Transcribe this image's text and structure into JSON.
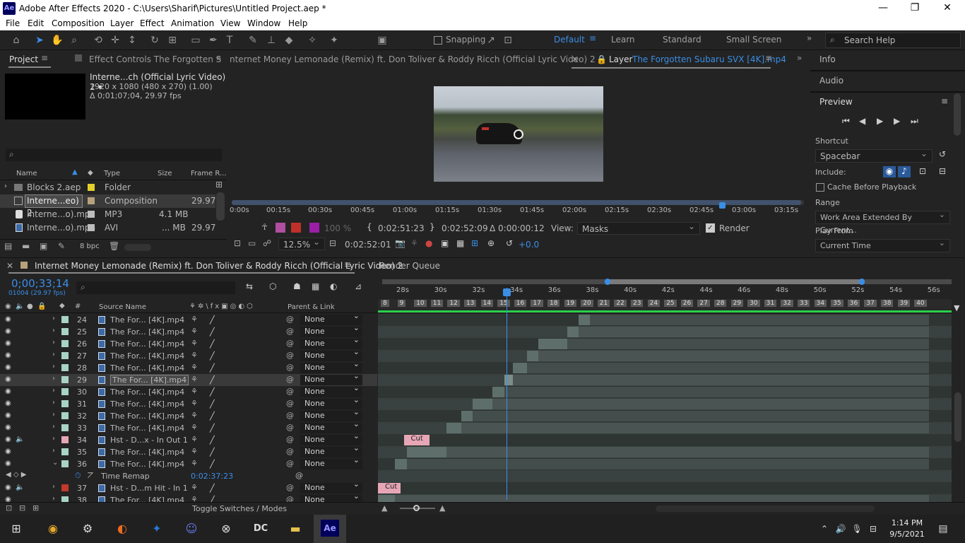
{
  "window": {
    "title": "Adobe After Effects 2020 - C:\\Users\\Sharif\\Pictures\\Untitled Project.aep *",
    "app_badge": "Ae",
    "minimize": "—",
    "restore": "❐",
    "close": "✕"
  },
  "menu": [
    "File",
    "Edit",
    "Composition",
    "Layer",
    "Effect",
    "Animation",
    "View",
    "Window",
    "Help"
  ],
  "toolbar": {
    "snapping": "Snapping",
    "workspaces": [
      "Default",
      "Learn",
      "Standard",
      "Small Screen"
    ],
    "search_placeholder": "Search Help"
  },
  "project": {
    "tab": "Project",
    "effect_controls": "Effect Controls The Forgotten S",
    "comp_name": "Interne...ch (Official Lyric Video) 2 ▾",
    "comp_size": "1920 x 1080  (480 x 270) (1.00)",
    "comp_dur": "Δ 0;01;07;04, 29.97 fps",
    "search_placeholder": "",
    "columns": [
      "Name",
      "Type",
      "Size",
      "Frame R..."
    ],
    "items": [
      {
        "name": "Blocks 2.aep",
        "type": "Folder",
        "size": "",
        "fps": "",
        "color": "#e6d02a"
      },
      {
        "name": "Interne...eo) 2",
        "type": "Composition",
        "size": "",
        "fps": "29.97",
        "color": "#b7a17c"
      },
      {
        "name": "Interne...o).mp3",
        "type": "MP3",
        "size": "4.1 MB",
        "fps": "",
        "color": "#bcbcbc"
      },
      {
        "name": "Interne...o).mp4",
        "type": "AVI",
        "size": "... MB",
        "fps": "29.97",
        "color": "#bcbcbc"
      }
    ],
    "bpc": "8 bpc"
  },
  "viewer": {
    "comp_tab": "nternet Money Lemonade (Remix) ft. Don Toliver & Roddy Ricch (Official Lyric Video) 2",
    "layer_tab_prefix": "Layer",
    "layer_tab_name": "The Forgotten Subaru  SVX [4K].mp4",
    "ruler": [
      "0:00s",
      "00:15s",
      "00:30s",
      "00:45s",
      "01:00s",
      "01:15s",
      "01:30s",
      "01:45s",
      "02:00s",
      "02:15s",
      "02:30s",
      "02:45s",
      "03:00s",
      "03:15s"
    ],
    "percent": "100 %",
    "in_time": "0:02:51:23",
    "out_time": "0:02:52:09",
    "duration": "Δ 0:00:00:12",
    "view_label": "View:",
    "view_value": "Masks",
    "render": "Render",
    "zoom": "12.5%",
    "current": "0:02:52:01",
    "exposure": "+0.0"
  },
  "right": {
    "info": "Info",
    "audio": "Audio",
    "preview": "Preview",
    "shortcut_label": "Shortcut",
    "shortcut": "Spacebar",
    "include": "Include:",
    "cache": "Cache Before Playback",
    "range_label": "Range",
    "range": "Work Area Extended By Current...",
    "playfrom_label": "Play From",
    "playfrom": "Current Time"
  },
  "timeline": {
    "tab": "Internet Money Lemonade (Remix) ft. Don Toliver & Roddy Ricch (Official Lyric Video) 2",
    "render_queue": "Render Queue",
    "timecode": "0;00;33;14",
    "frames": "01004 (29.97 fps)",
    "col_source": "Source Name",
    "col_parent": "Parent & Link",
    "toggle": "Toggle Switches / Modes",
    "ruler": [
      "28s",
      "30s",
      "32s",
      "34s",
      "36s",
      "38s",
      "40s",
      "42s",
      "44s",
      "46s",
      "48s",
      "50s",
      "52s",
      "54s",
      "56s"
    ],
    "markers": [
      "8",
      "9",
      "10",
      "11",
      "12",
      "13",
      "14",
      "15",
      "16",
      "17",
      "18",
      "19",
      "20",
      "21",
      "22",
      "23",
      "24",
      "25",
      "26",
      "27",
      "28",
      "29",
      "30",
      "31",
      "32",
      "33",
      "34",
      "35",
      "36",
      "37",
      "38",
      "39",
      "40"
    ],
    "layers": [
      {
        "num": "24",
        "name": "The For... [4K].mp4",
        "parent": "None",
        "color": "#a8d3c7",
        "bar": [
          0.35,
          0.37
        ]
      },
      {
        "num": "25",
        "name": "The For... [4K].mp4",
        "parent": "None",
        "color": "#a8d3c7",
        "bar": [
          0.33,
          0.35
        ]
      },
      {
        "num": "26",
        "name": "The For... [4K].mp4",
        "parent": "None",
        "color": "#a8d3c7",
        "bar": [
          0.28,
          0.33
        ]
      },
      {
        "num": "27",
        "name": "The For... [4K].mp4",
        "parent": "None",
        "color": "#a8d3c7",
        "bar": [
          0.26,
          0.28
        ]
      },
      {
        "num": "28",
        "name": "The For... [4K].mp4",
        "parent": "None",
        "color": "#a8d3c7",
        "bar": [
          0.235,
          0.26
        ]
      },
      {
        "num": "29",
        "name": "The For... [4K].mp4",
        "parent": "None",
        "color": "#a8d3c7",
        "bar": [
          0.22,
          0.235
        ],
        "selected": true
      },
      {
        "num": "30",
        "name": "The For... [4K].mp4",
        "parent": "None",
        "color": "#a8d3c7",
        "bar": [
          0.2,
          0.22
        ]
      },
      {
        "num": "31",
        "name": "The For... [4K].mp4",
        "parent": "None",
        "color": "#a8d3c7",
        "bar": [
          0.165,
          0.2
        ]
      },
      {
        "num": "32",
        "name": "The For... [4K].mp4",
        "parent": "None",
        "color": "#a8d3c7",
        "bar": [
          0.145,
          0.165
        ]
      },
      {
        "num": "33",
        "name": "The For... [4K].mp4",
        "parent": "None",
        "color": "#a8d3c7",
        "bar": [
          0.12,
          0.145
        ]
      },
      {
        "num": "34",
        "name": "Hst - D...x - In Out 1",
        "parent": "None",
        "color": "#e6a6b6",
        "bar": [
          0.045,
          0.09
        ],
        "label": "Cut"
      },
      {
        "num": "35",
        "name": "The For... [4K].mp4",
        "parent": "None",
        "color": "#a8d3c7",
        "bar": [
          0.05,
          0.12
        ]
      },
      {
        "num": "36",
        "name": "The For... [4K].mp4",
        "parent": "None",
        "color": "#a8d3c7",
        "bar": [
          0.03,
          0.05
        ]
      },
      {
        "num": "",
        "name": "Time Remap",
        "parent": "",
        "color": "",
        "value": "0:02:37:23"
      },
      {
        "num": "37",
        "name": "Hst - D...m Hit - In 1",
        "parent": "None",
        "color": "#c0392b",
        "bar": [
          0.0,
          0.04
        ],
        "label": "Cut"
      },
      {
        "num": "38",
        "name": "The For... [4K].mp4",
        "parent": "None",
        "color": "#a8d3c7",
        "bar": [
          0.0,
          0.03
        ]
      }
    ]
  },
  "taskbar": {
    "time": "1:14 PM",
    "date": "9/5/2021"
  }
}
